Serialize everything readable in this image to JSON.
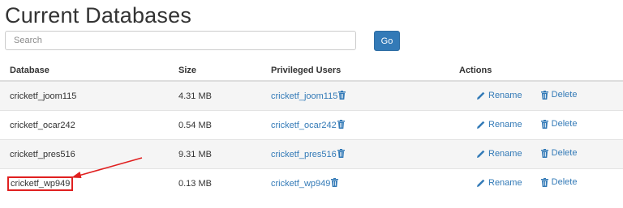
{
  "page": {
    "title": "Current Databases"
  },
  "search": {
    "placeholder": "Search",
    "button_label": "Go"
  },
  "table": {
    "headers": {
      "database": "Database",
      "size": "Size",
      "users": "Privileged Users",
      "actions": "Actions"
    },
    "rows": [
      {
        "database": "cricketf_joom115",
        "size": "4.31 MB",
        "user": "cricketf_joom115"
      },
      {
        "database": "cricketf_ocar242",
        "size": "0.54 MB",
        "user": "cricketf_ocar242"
      },
      {
        "database": "cricketf_pres516",
        "size": "9.31 MB",
        "user": "cricketf_pres516"
      },
      {
        "database": "cricketf_wp949",
        "size": "0.13 MB",
        "user": "cricketf_wp949",
        "highlighted": true
      }
    ],
    "actions": {
      "rename": "Rename",
      "delete": "Delete"
    }
  },
  "colors": {
    "accent": "#337ab7",
    "highlight": "#e02020",
    "stripe": "#f5f5f5"
  },
  "icons": [
    "pencil-icon",
    "trash-icon",
    "arrow-annotation"
  ]
}
